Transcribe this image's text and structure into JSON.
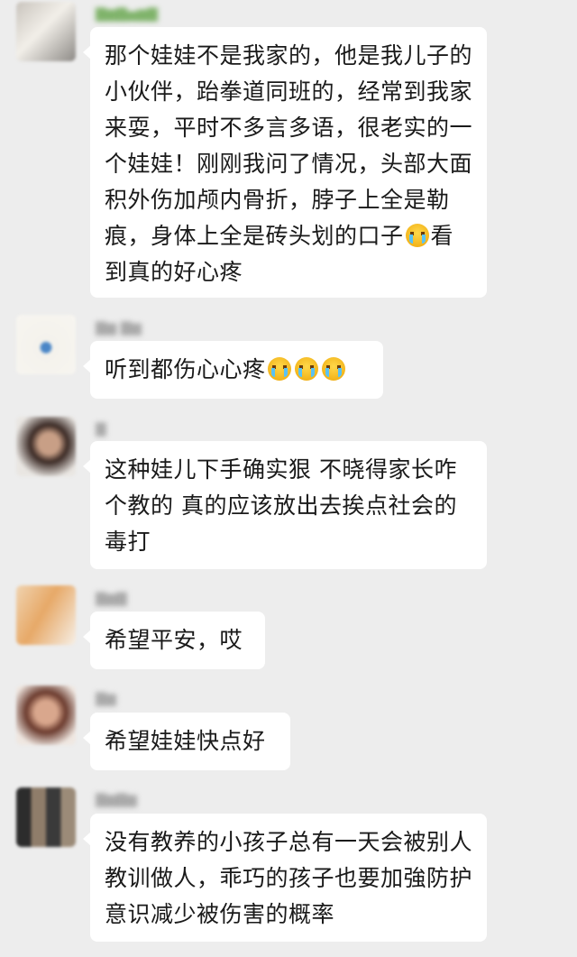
{
  "messages": [
    {
      "sender": "▇▆▇▅▆▇",
      "text_parts": [
        "那个娃娃不是我家的，他是我儿子的小伙伴，跆拳道同班的，经常到我家来耍，平时不多言多语，很老实的一个娃娃！刚刚我问了情况，头部大面积外伤加颅内骨折，脖子上全是勒痕，身体上全是砖头划的口子",
        "看到真的好心疼"
      ],
      "emoji": [
        "crying-face"
      ]
    },
    {
      "sender": "▇▆ ▇▆",
      "text": "听到都伤心心疼",
      "emoji": [
        "crying-face",
        "crying-face",
        "crying-face"
      ]
    },
    {
      "sender": "▇",
      "text": "这种娃儿下手确实狠 不晓得家长咋个教的 真的应该放出去挨点社会的毒打"
    },
    {
      "sender": "▇▆▇",
      "text": "希望平安，哎"
    },
    {
      "sender": "▇▆",
      "text": "希望娃娃快点好"
    },
    {
      "sender": "▇▆▇▆",
      "text": "没有教养的小孩子总有一天会被别人教训做人，乖巧的孩子也要加強防护意识减少被伤害的概率"
    }
  ],
  "colors": {
    "background": "#ededed",
    "bubble": "#ffffff",
    "text": "#1a1a1a"
  }
}
